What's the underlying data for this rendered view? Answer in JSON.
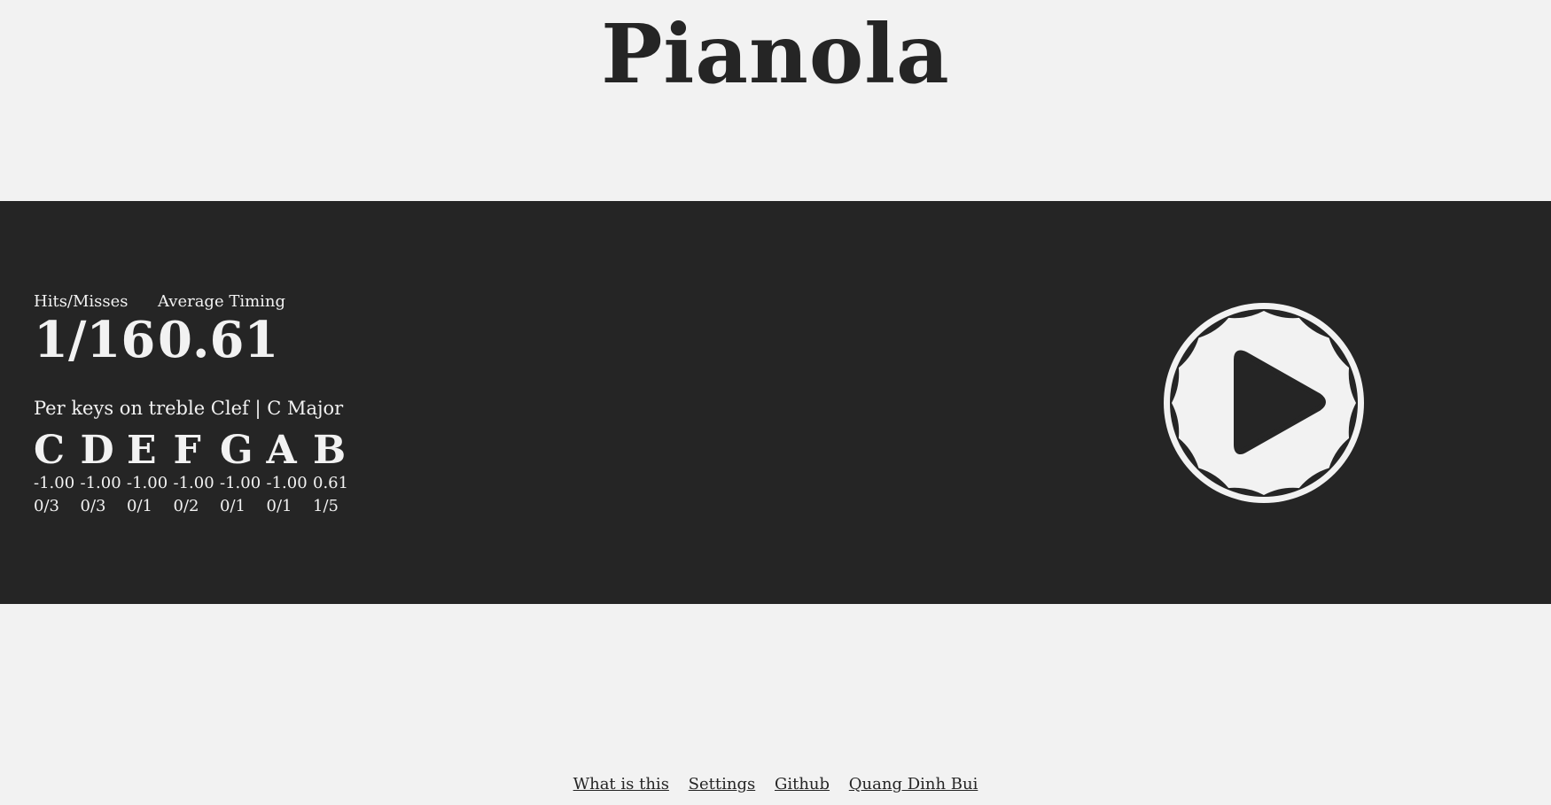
{
  "app": {
    "title": "Pianola"
  },
  "stats": {
    "hits_misses_label": "Hits/Misses",
    "hits_misses_value": "1/16",
    "avg_timing_label": "Average Timing",
    "avg_timing_value": "0.61"
  },
  "per_keys": {
    "label": "Per keys on treble Clef | C Major",
    "keys": [
      {
        "note": "C",
        "timing": "-1.00",
        "hits": "0/3"
      },
      {
        "note": "D",
        "timing": "-1.00",
        "hits": "0/3"
      },
      {
        "note": "E",
        "timing": "-1.00",
        "hits": "0/1"
      },
      {
        "note": "F",
        "timing": "-1.00",
        "hits": "0/2"
      },
      {
        "note": "G",
        "timing": "-1.00",
        "hits": "0/1"
      },
      {
        "note": "A",
        "timing": "-1.00",
        "hits": "0/1"
      },
      {
        "note": "B",
        "timing": "0.61",
        "hits": "1/5"
      }
    ]
  },
  "play_button": {
    "icon": "play-icon"
  },
  "footer": {
    "links": [
      {
        "label": "What is this"
      },
      {
        "label": "Settings"
      },
      {
        "label": "Github"
      },
      {
        "label": "Quang Dinh Bui"
      }
    ]
  },
  "colors": {
    "background": "#f2f2f2",
    "band": "#252525",
    "text_light": "#f2f2f2",
    "text_dark": "#252525"
  }
}
